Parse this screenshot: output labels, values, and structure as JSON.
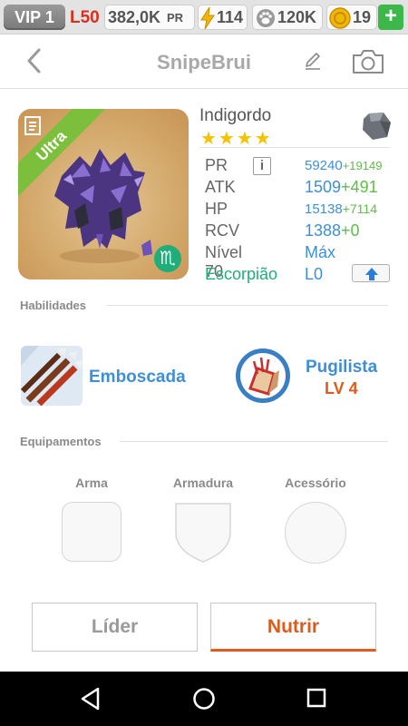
{
  "status": {
    "vip": "VIP 1",
    "level": "L50",
    "pr_value": "382,0K",
    "pr_unit": "PR",
    "energy": "114",
    "food": "120K",
    "coins": "19",
    "add_label": "+"
  },
  "header": {
    "title": "SnipeBrui"
  },
  "monster": {
    "name": "Indigordo",
    "rarity": "Ultra",
    "stars": "★★★★",
    "zodiac_symbol": "♏",
    "stats": {
      "pr_label": "PR",
      "pr_value": "59240",
      "pr_bonus": "+19149",
      "info_label": "i",
      "atk_label": "ATK",
      "atk_value": "1509",
      "atk_bonus": "+491",
      "hp_label": "HP",
      "hp_value": "15138",
      "hp_bonus": "+7114",
      "rcv_label": "RCV",
      "rcv_value": "1388",
      "rcv_bonus": "+0",
      "level_label": "Nível 70",
      "level_value": "Máx",
      "sign_label": "Escorpião",
      "sign_value": "L0"
    }
  },
  "skills": {
    "section_title": "Habilidades",
    "items": [
      {
        "name": "Emboscada"
      },
      {
        "name": "Pugilista",
        "level": "LV 4"
      }
    ]
  },
  "equipment": {
    "section_title": "Equipamentos",
    "slots": [
      {
        "label": "Arma"
      },
      {
        "label": "Armadura"
      },
      {
        "label": "Acessório"
      }
    ]
  },
  "actions": {
    "leader": "Líder",
    "feed": "Nutrir"
  },
  "colors": {
    "accent_blue": "#3f8fd6",
    "bonus_green": "#5dbe4a",
    "accent_orange": "#e05a1c",
    "rarity_green": "#7bbf3c",
    "zodiac_green": "#1fae79",
    "star_gold": "#f4c200"
  }
}
